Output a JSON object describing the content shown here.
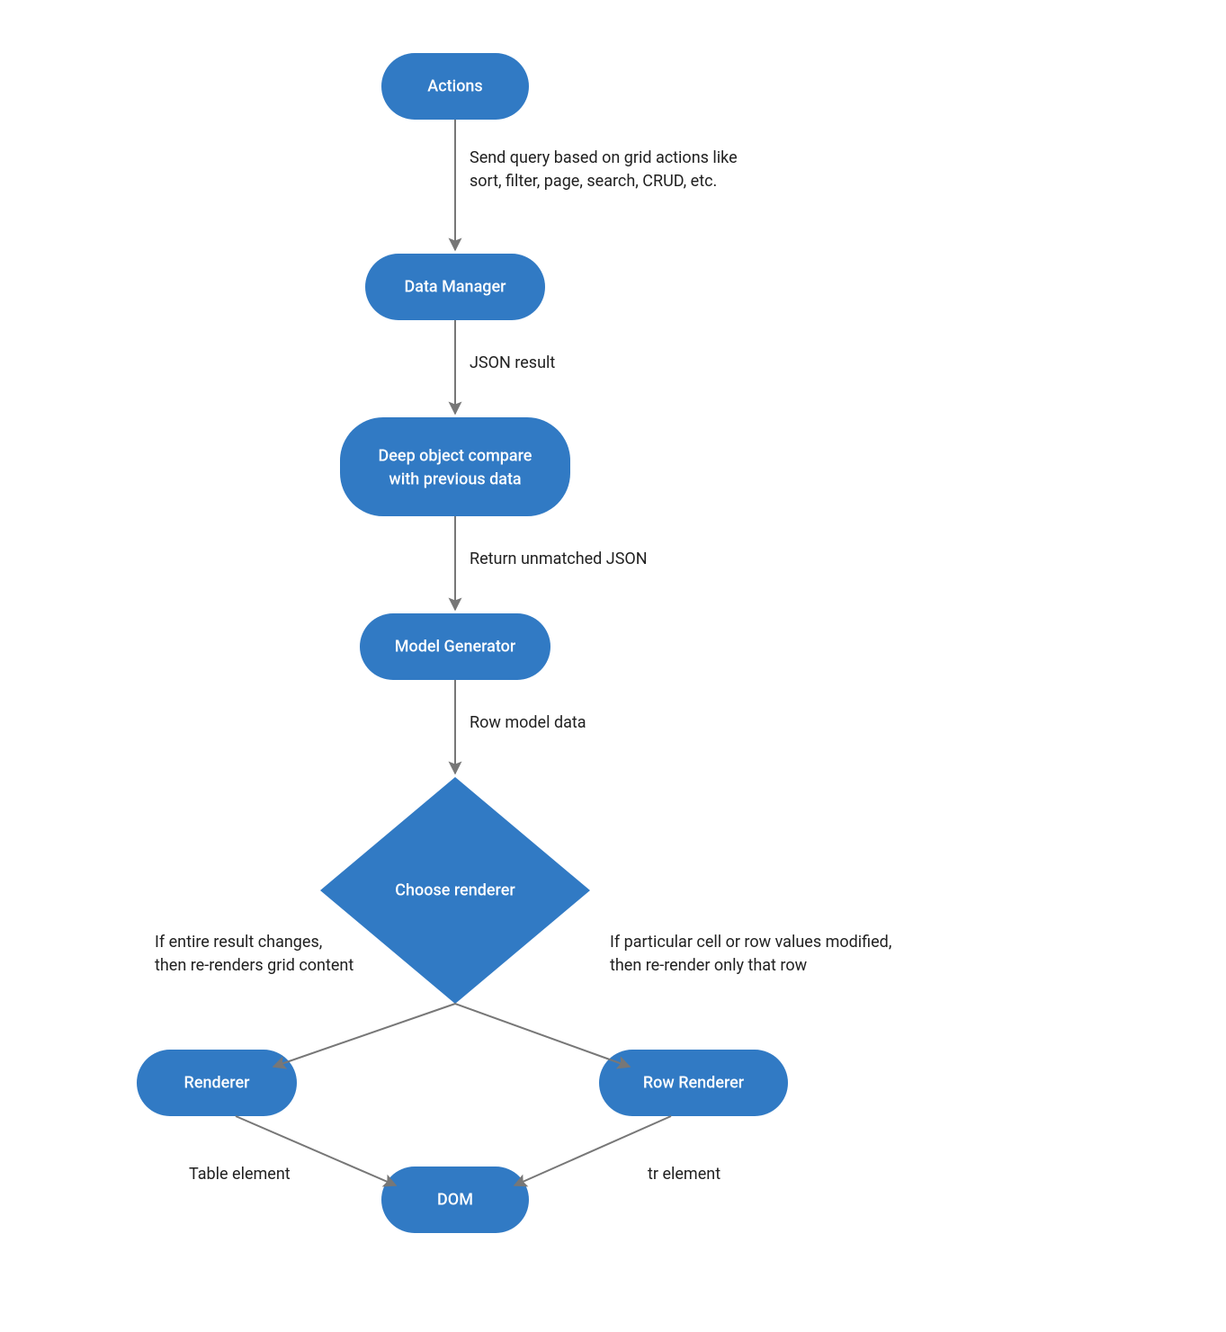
{
  "colors": {
    "node_fill": "#317ac4",
    "node_text": "#ffffff",
    "edge_stroke": "#777777",
    "label_text": "#212121"
  },
  "nodes": {
    "actions": {
      "label": "Actions"
    },
    "data_manager": {
      "label": "Data Manager"
    },
    "deep_compare": {
      "line1": "Deep object compare",
      "line2": "with previous data"
    },
    "model_gen": {
      "label": "Model Generator"
    },
    "choose": {
      "label": "Choose renderer"
    },
    "renderer": {
      "label": "Renderer"
    },
    "row_renderer": {
      "label": "Row Renderer"
    },
    "dom": {
      "label": "DOM"
    }
  },
  "edges": {
    "actions_to_dm": {
      "line1": "Send query based on grid actions like",
      "line2": "sort, filter, page, search, CRUD, etc."
    },
    "dm_to_compare": {
      "label": "JSON result"
    },
    "compare_to_mg": {
      "label": "Return unmatched JSON"
    },
    "mg_to_choose": {
      "label": "Row model data"
    },
    "choose_left": {
      "line1": "If entire result changes,",
      "line2": "then re-renders grid content"
    },
    "choose_right": {
      "line1": "If particular cell or row values modified,",
      "line2": "then re-render only that row"
    },
    "renderer_to_dom": {
      "label": "Table element"
    },
    "rowr_to_dom": {
      "label": "tr element"
    }
  }
}
